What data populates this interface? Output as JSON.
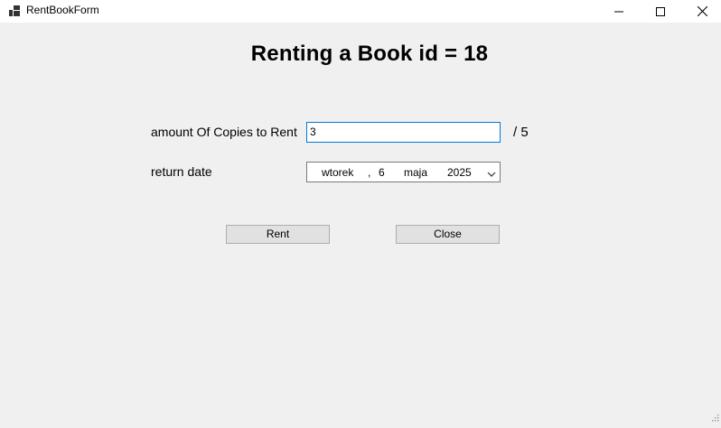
{
  "window": {
    "title": "RentBookForm",
    "controls": {
      "minimize": "minimize-icon",
      "maximize": "maximize-icon",
      "close": "close-icon"
    }
  },
  "form": {
    "heading": "Renting a Book id = 18",
    "copies_label": "amount Of Copies to Rent",
    "copies_value": "3",
    "copies_max": "/ 5",
    "return_date_label": "return date",
    "return_date": {
      "weekday": "wtorek",
      "separator": ",",
      "day": "6",
      "month": "maja",
      "year": "2025"
    },
    "rent_button": "Rent",
    "close_button": "Close"
  },
  "colors": {
    "background": "#f0f0f0",
    "titlebar": "#ffffff",
    "focus_border": "#0078d7",
    "button": "#e1e1e1"
  }
}
